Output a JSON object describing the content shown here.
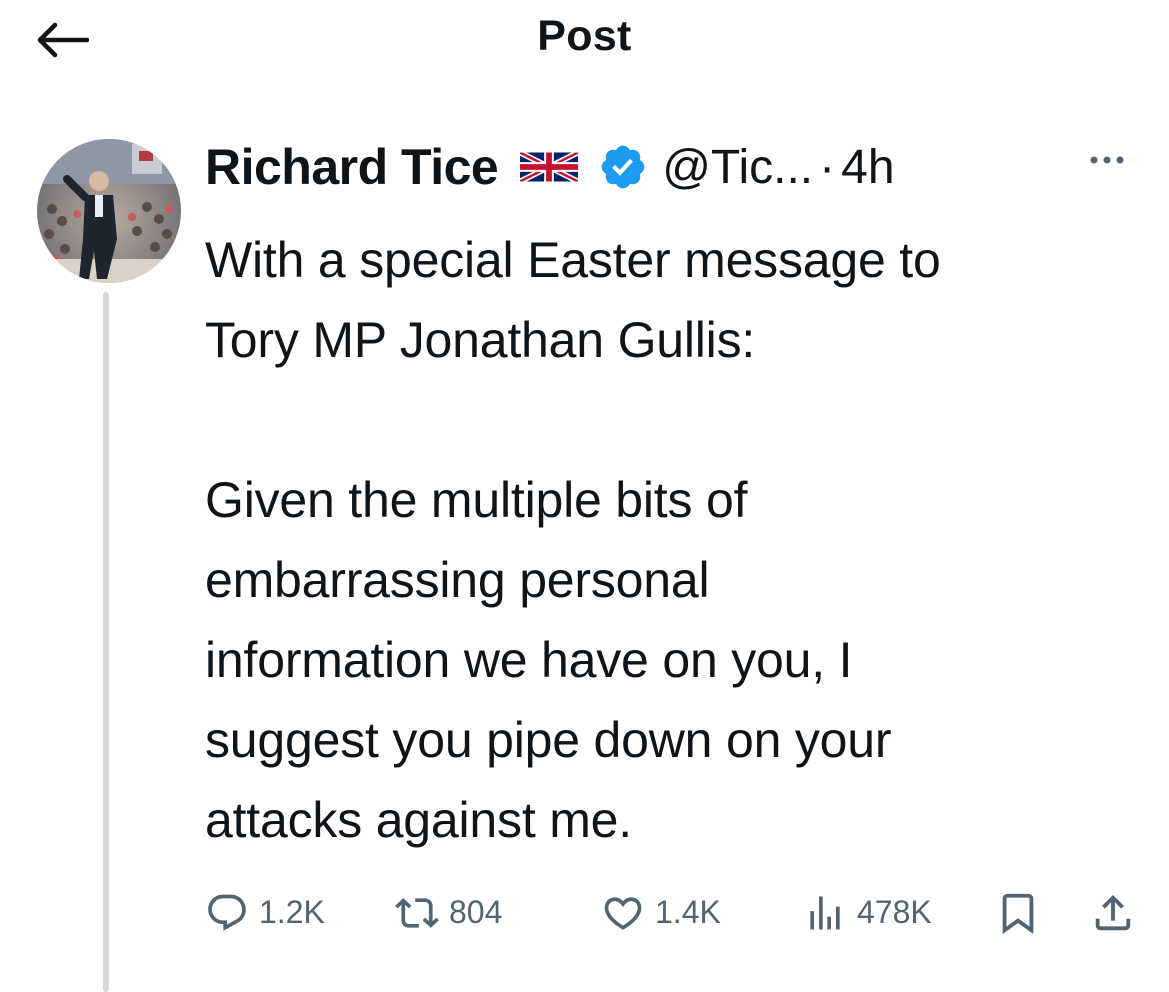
{
  "header": {
    "title": "Post",
    "back_icon": "arrow-left-icon"
  },
  "tweet": {
    "author_name": "Richard Tice",
    "flag_icon": "union-jack-flag-icon",
    "verified_icon": "verified-badge-icon",
    "verified_color": "#1d9bf0",
    "handle": "@Tic...",
    "separator": "·",
    "time": "4h",
    "more_icon": "more-dots-icon",
    "text": "With a special Easter message to\nTory MP Jonathan Gullis:\n\nGiven the multiple bits of\nembarrassing personal\ninformation we have on you, I\nsuggest you pipe down on your\nattacks against me."
  },
  "actions": {
    "reply": {
      "icon": "reply-icon",
      "count": "1.2K"
    },
    "repost": {
      "icon": "repost-icon",
      "count": "804"
    },
    "like": {
      "icon": "heart-icon",
      "count": "1.4K"
    },
    "views": {
      "icon": "views-bar-chart-icon",
      "count": "478K"
    },
    "bookmark": {
      "icon": "bookmark-icon"
    },
    "share": {
      "icon": "share-icon"
    }
  },
  "colors": {
    "text_primary": "#0f1419",
    "text_secondary": "#536471",
    "thread_line": "#cfd9de",
    "accent": "#1d9bf0"
  }
}
